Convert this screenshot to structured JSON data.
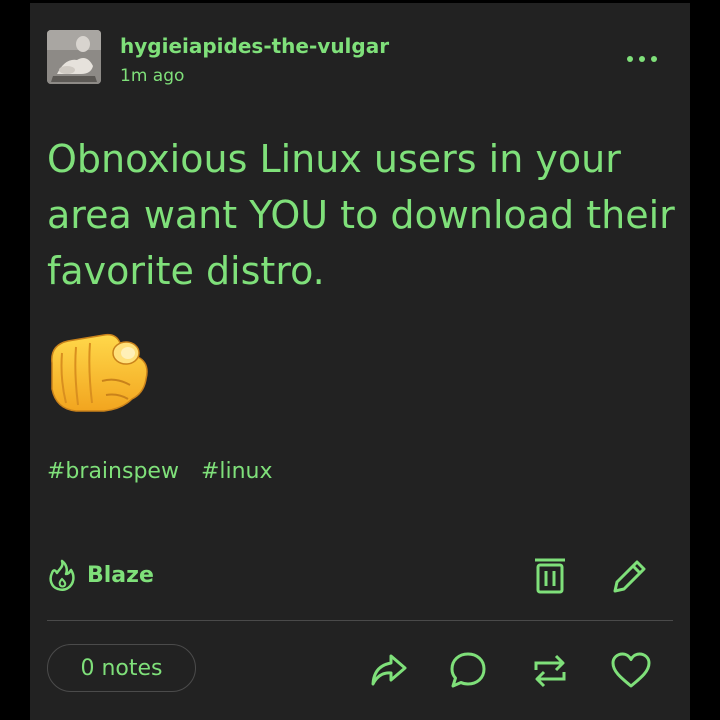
{
  "post": {
    "username": "hygieiapides-the-vulgar",
    "timestamp": "1m ago",
    "text": "Obnoxious Linux users in your area want YOU to download their favorite distro.",
    "emoji": "pointing-at-viewer-emoji",
    "tags": [
      "#brainspew",
      "#linux"
    ]
  },
  "actions": {
    "blaze_label": "Blaze",
    "notes_label": "0 notes",
    "icons": [
      "more-icon",
      "blaze-icon",
      "delete-icon",
      "edit-icon",
      "share-icon",
      "reply-icon",
      "reblog-icon",
      "like-icon"
    ]
  },
  "colors": {
    "accent": "#7fe07a",
    "card_background": "#222222",
    "page_background": "#000000"
  }
}
